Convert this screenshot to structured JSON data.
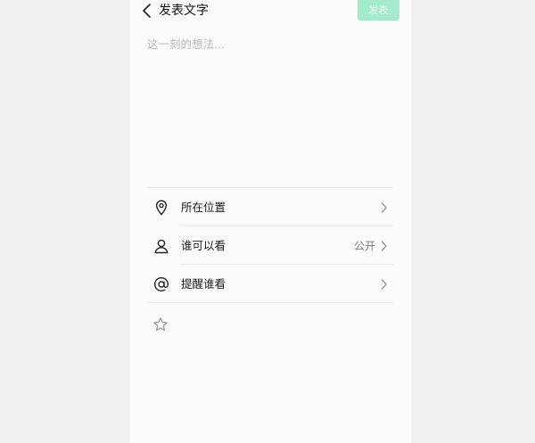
{
  "screen": {
    "title": "发表文字",
    "publish_label": "发表"
  },
  "editor": {
    "placeholder": "这一刻的想法..."
  },
  "options": [
    {
      "label": "所在位置",
      "value": "",
      "icon": "location-pin-icon"
    },
    {
      "label": "谁可以看",
      "value": "公开",
      "icon": "person-icon"
    },
    {
      "label": "提醒谁看",
      "value": "",
      "icon": "at-sign-icon"
    }
  ],
  "extras": {
    "star_icon": "star-icon"
  },
  "colors": {
    "accent": "#a4ebcb",
    "background": "#fbfbfb",
    "page_backdrop": "#f0f0f0",
    "divider": "#ececec"
  }
}
